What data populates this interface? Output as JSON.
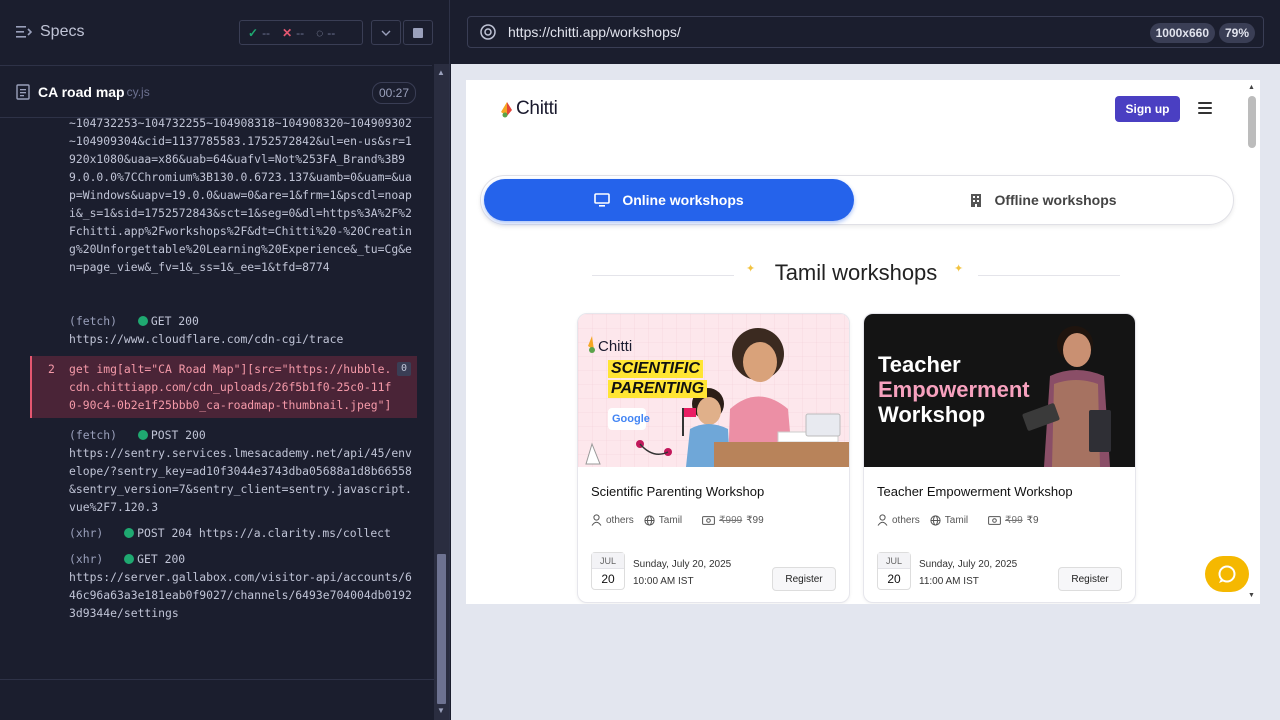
{
  "runner": {
    "specs_label": "Specs",
    "stats": {
      "passed": "--",
      "failed": "--",
      "pending": "--"
    },
    "spec": {
      "name": "CA road map",
      "ext": "cy.js",
      "timer": "00:27"
    },
    "log": {
      "continued_url": "~104732253~104732255~104908318~104908320~104909302~104909304&cid=1137785583.1752572842&ul=en-us&sr=1920x1080&uaa=x86&uab=64&uafvl=Not%253FA_Brand%3B99.0.0.0%7CChromium%3B130.0.6723.137&uamb=0&uam=&uap=Windows&uapv=19.0.0&uaw=0&are=1&frm=1&pscdl=noapi&_s=1&sid=1752572843&sct=1&seg=0&dl=https%3A%2F%2Fchitti.app%2Fworkshops%2F&dt=Chitti%20-%20Creating%20Unforgettable%20Learning%20Experience&_tu=Cg&en=page_view&_fv=1&_ss=1&_ee=1&tfd=8774",
      "fetch1_prefix": "(fetch)",
      "fetch1_method": "GET 200",
      "fetch1_url": "https://www.cloudflare.com/cdn-cgi/trace",
      "cmd_num": "2",
      "cmd_text": "get  img[alt=\"CA Road Map\"][src=\"https://hubble.cdn.chittiapp.com/cdn_uploads/26f5b1f0-25c0-11f0-90c4-0b2e1f25bbb0_ca-roadmap-thumbnail.jpeg\"]",
      "cmd_badge": "0",
      "fetch2_prefix": "(fetch)",
      "fetch2_method": "POST 200",
      "fetch2_url": "https://sentry.services.lmesacademy.net/api/45/envelope/?sentry_key=ad10f3044e3743dba05688a1d8b66558&sentry_version=7&sentry_client=sentry.javascript.vue%2F7.120.3",
      "xhr1_prefix": "(xhr)",
      "xhr1_text": "POST 204 https://a.clarity.ms/collect",
      "xhr2_prefix": "(xhr)",
      "xhr2_method": "GET 200",
      "xhr2_url": "https://server.gallabox.com/visitor-api/accounts/646c96a63a3e181eab0f9027/channels/6493e704004db01923d9344e/settings"
    }
  },
  "aut_bar": {
    "url": "https://chitti.app/workshops/",
    "viewport": "1000x660",
    "zoom": "79%"
  },
  "site": {
    "logo_text": "Chitti",
    "signup_label": "Sign up",
    "tabs": {
      "online": "Online workshops",
      "offline": "Offline workshops"
    },
    "section_title": "Tamil workshops",
    "cards": [
      {
        "title": "Scientific Parenting Workshop",
        "audience": "others",
        "language": "Tamil",
        "price_old": "₹999",
        "price_new": "₹99",
        "month": "JUL",
        "day": "20",
        "date": "Sunday, July 20, 2025",
        "time": "10:00 AM IST",
        "register": "Register",
        "thumb": {
          "brand": "Chitti",
          "line1": "SCIENTIFIC",
          "line2": "PARENTING",
          "badge": "Google"
        }
      },
      {
        "title": "Teacher Empowerment Workshop",
        "audience": "others",
        "language": "Tamil",
        "price_old": "₹99",
        "price_new": "₹9",
        "month": "JUL",
        "day": "20",
        "date": "Sunday, July 20, 2025",
        "time": "11:00 AM IST",
        "register": "Register",
        "thumb": {
          "line1": "Teacher",
          "line2": "Empowerment",
          "line3": "Workshop"
        }
      }
    ]
  },
  "colors": {
    "runner_bg": "#1b1e2e",
    "pass": "#1fa971",
    "fail": "#e45770",
    "signup": "#4a3fc2",
    "tab_active": "#2563eb",
    "chat": "#f5b800"
  }
}
